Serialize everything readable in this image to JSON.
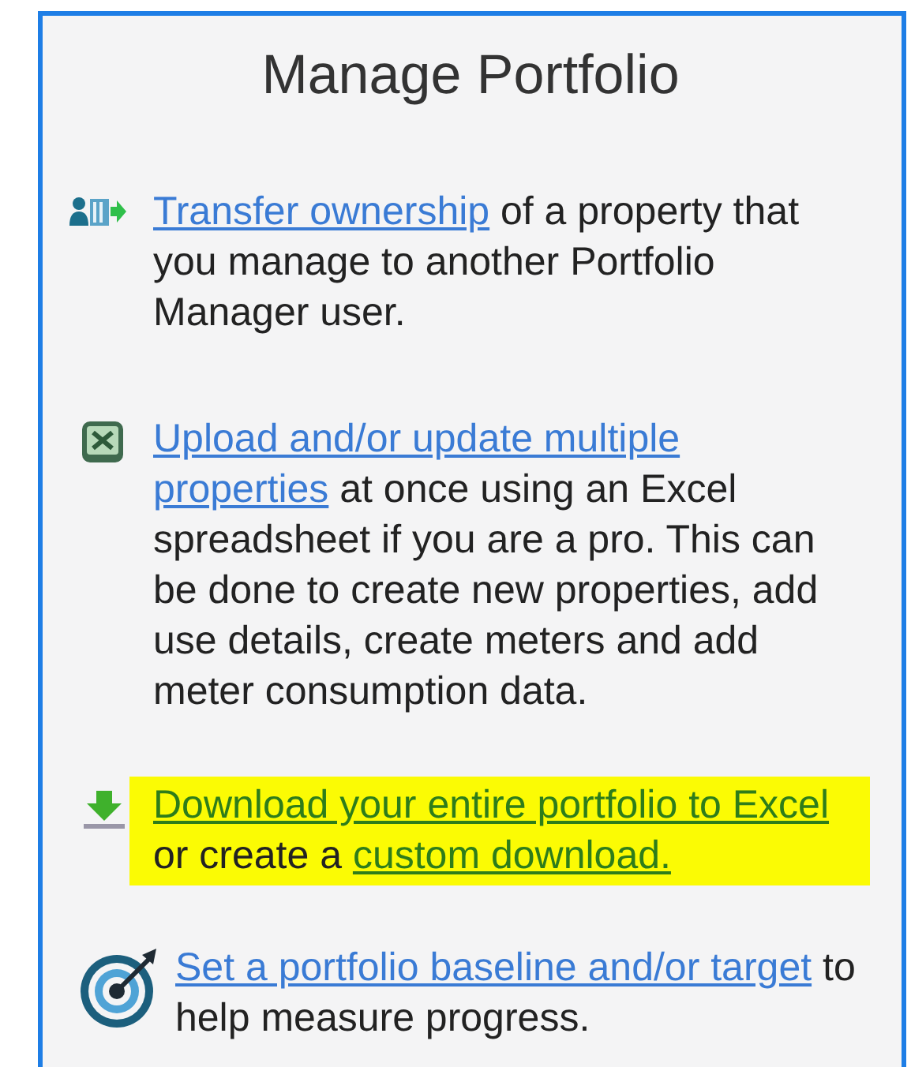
{
  "title": "Manage Portfolio",
  "items": [
    {
      "kind": "transfer",
      "highlighted": false,
      "parts": [
        {
          "text": "Transfer ownership",
          "link": true
        },
        {
          "text": " of a property that you manage to another Portfolio Manager user.",
          "link": false
        }
      ]
    },
    {
      "kind": "spreadsheet",
      "highlighted": false,
      "parts": [
        {
          "text": "Upload and/or update multiple",
          "link": true
        },
        {
          "text": "properties",
          "link": true
        },
        {
          "text": " at once using an Excel spreadsheet if you are a pro. This can be done to create new properties, add use details, create meters and add meter consumption data.",
          "link": false
        }
      ]
    },
    {
      "kind": "download",
      "highlighted": true,
      "parts": [
        {
          "text": "Download your entire portfolio to Excel",
          "link": true
        },
        {
          "text": " or create a ",
          "link": false
        },
        {
          "text": "custom download.",
          "link": true
        }
      ]
    },
    {
      "kind": "target",
      "highlighted": false,
      "parts": [
        {
          "text": "Set a portfolio baseline and/or target",
          "link": true
        },
        {
          "text": " to help measure progress.",
          "link": false
        }
      ]
    }
  ]
}
